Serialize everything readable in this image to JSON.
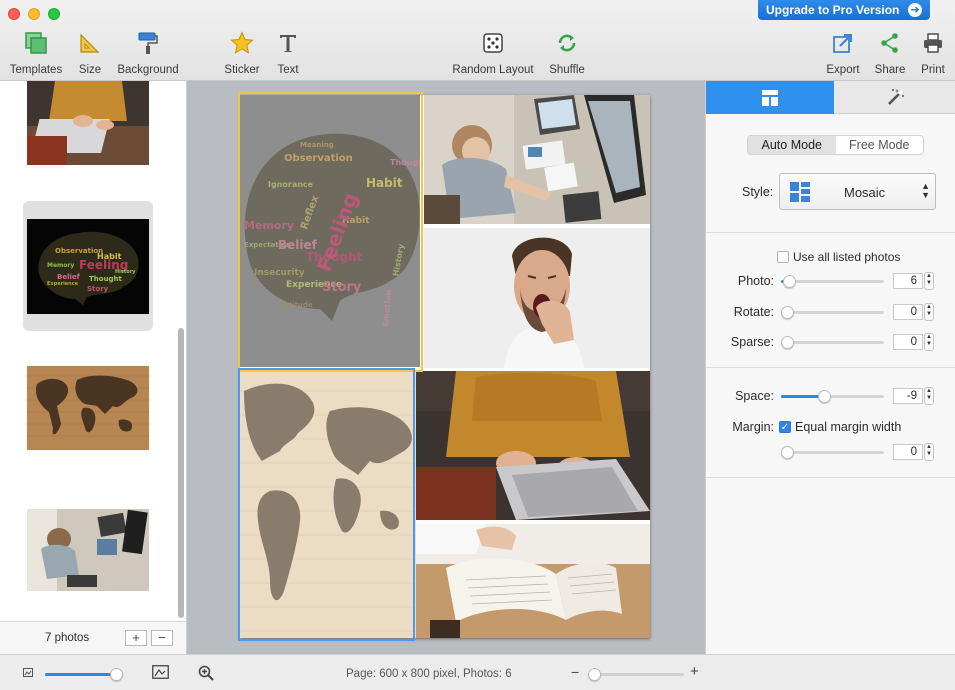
{
  "window": {
    "upgrade_label": "Upgrade to Pro Version"
  },
  "toolbar": {
    "templates": "Templates",
    "size": "Size",
    "background": "Background",
    "sticker": "Sticker",
    "text": "Text",
    "random_layout": "Random Layout",
    "shuffle": "Shuffle",
    "export": "Export",
    "share": "Share",
    "print": "Print"
  },
  "sidebar": {
    "photo_count": "7 photos",
    "add_label": "+",
    "remove_label": "−",
    "thumbnails": [
      "person-laptop",
      "word-cloud-brain",
      "world-map-wood",
      "man-at-desk"
    ],
    "selected_index": 1
  },
  "canvas": {
    "cells": [
      "word-cloud-brain",
      "man-at-desk",
      "yawning-man",
      "world-map-wood",
      "person-laptop",
      "open-book"
    ],
    "cloud_words": [
      "Feeling",
      "Belief",
      "Thought",
      "Habit",
      "Story",
      "Memory",
      "Observation",
      "Reflex",
      "Ignorance",
      "Experience",
      "Emotion",
      "Insecurity",
      "Attitude",
      "Meaning",
      "Expectation",
      "History"
    ]
  },
  "panel": {
    "tabs": [
      "layout-icon",
      "magic-wand-icon"
    ],
    "mode_auto": "Auto Mode",
    "mode_free": "Free Mode",
    "style_label": "Style:",
    "style_value": "Mosaic",
    "use_all_label": "Use all listed photos",
    "use_all_checked": false,
    "photo_label": "Photo:",
    "photo_value": "6",
    "rotate_label": "Rotate:",
    "rotate_value": "0",
    "sparse_label": "Sparse:",
    "sparse_value": "0",
    "space_label": "Space:",
    "space_value": "-9",
    "margin_label": "Margin:",
    "equal_margin_label": "Equal margin width",
    "equal_margin_checked": true,
    "margin_value": "0"
  },
  "status": {
    "text": "Page: 600 x 800 pixel, Photos: 6"
  },
  "colors": {
    "accent": "#2f90ee",
    "selection_yellow": "#f5c542",
    "selection_blue": "#4a9bf0"
  }
}
